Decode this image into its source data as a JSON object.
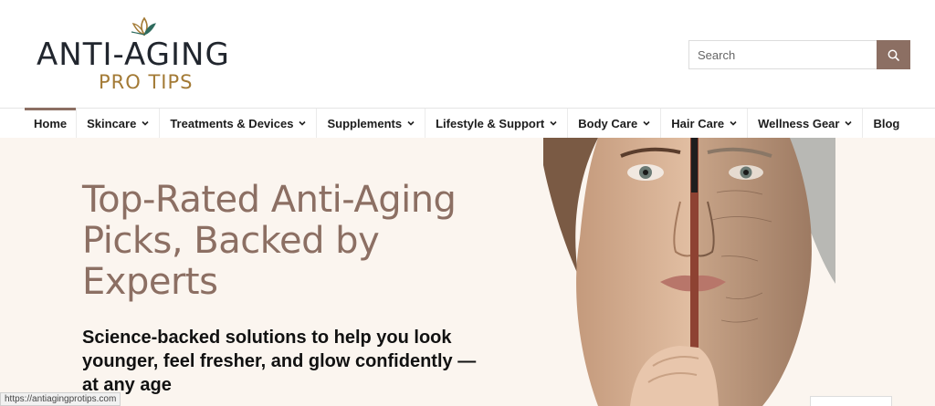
{
  "brand": {
    "logo_main": "ANTI-AGING",
    "logo_sub": "PRO TIPS",
    "colors": {
      "accent": "#8c6f63",
      "gold": "#a37a35",
      "dark": "#21262e",
      "hero_bg": "#fbf5ef"
    }
  },
  "search": {
    "placeholder": "Search",
    "value": "",
    "icon": "search-icon"
  },
  "nav": {
    "items": [
      {
        "label": "Home",
        "has_dropdown": false,
        "active": true
      },
      {
        "label": "Skincare",
        "has_dropdown": true
      },
      {
        "label": "Treatments & Devices",
        "has_dropdown": true
      },
      {
        "label": "Supplements",
        "has_dropdown": true
      },
      {
        "label": "Lifestyle & Support",
        "has_dropdown": true
      },
      {
        "label": "Body Care",
        "has_dropdown": true
      },
      {
        "label": "Hair Care",
        "has_dropdown": true
      },
      {
        "label": "Wellness Gear",
        "has_dropdown": true
      },
      {
        "label": "Blog",
        "has_dropdown": false
      }
    ]
  },
  "hero": {
    "title": "Top-Rated Anti-Aging Picks, Backed by Experts",
    "subtitle": "Science-backed solutions to help you look younger, feel fresher, and glow confidently — at any age",
    "image": "split-face-young-old-woman-image"
  },
  "status_bar": {
    "url": "https://antiagingprotips.com"
  }
}
